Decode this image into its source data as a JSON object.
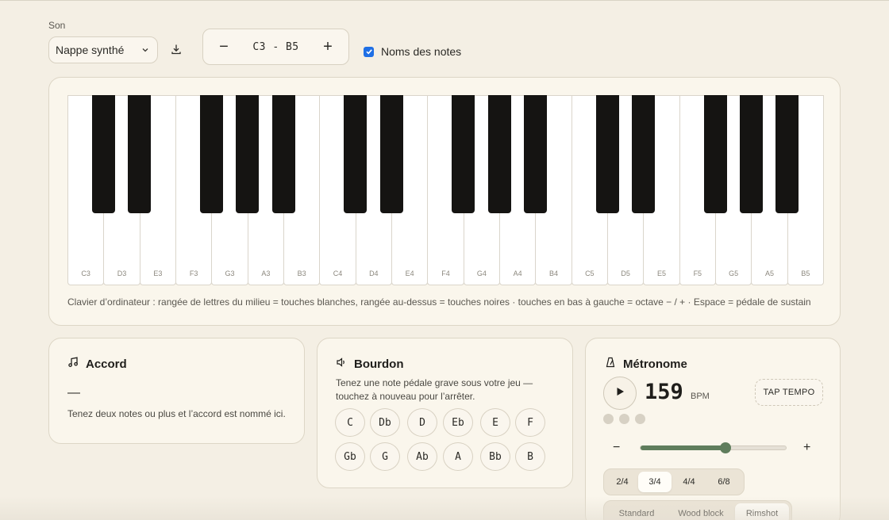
{
  "sound": {
    "label": "Son",
    "selected": "Nappe synthé"
  },
  "range": {
    "minus": "−",
    "text": "C3 - B5",
    "plus": "+"
  },
  "note_names": {
    "label": "Noms des notes",
    "checked": true
  },
  "keyboard": {
    "white_keys": [
      "C3",
      "D3",
      "E3",
      "F3",
      "G3",
      "A3",
      "B3",
      "C4",
      "D4",
      "E4",
      "F4",
      "G4",
      "A4",
      "B4",
      "C5",
      "D5",
      "E5",
      "F5",
      "G5",
      "A5",
      "B5"
    ],
    "help": "Clavier d’ordinateur : rangée de lettres du milieu = touches blanches, rangée au-dessus = touches noires · touches en bas à gauche = octave − / + · Espace = pédale de sustain"
  },
  "accord": {
    "title": "Accord",
    "current": "—",
    "hint": "Tenez deux notes ou plus et l’accord est nommé ici."
  },
  "bourdon": {
    "title": "Bourdon",
    "description": "Tenez une note pédale grave sous votre jeu — touchez à nouveau pour l’arrêter.",
    "notes": [
      "C",
      "Db",
      "D",
      "Eb",
      "E",
      "F",
      "Gb",
      "G",
      "Ab",
      "A",
      "Bb",
      "B"
    ]
  },
  "metronome": {
    "title": "Métronome",
    "bpm": "159",
    "bpm_unit": "BPM",
    "tap_label": "TAP TEMPO",
    "tempo_fraction": 0.58,
    "minus": "−",
    "plus": "+",
    "signatures": [
      "2/4",
      "3/4",
      "4/4",
      "6/8"
    ],
    "active_signature": "3/4",
    "sounds": [
      "Standard",
      "Wood block",
      "Rimshot"
    ],
    "active_sound": "Rimshot"
  },
  "colors": {
    "accent": "#5f7d5c",
    "checkbox": "#1f6fe5",
    "background": "#f4efe4"
  }
}
